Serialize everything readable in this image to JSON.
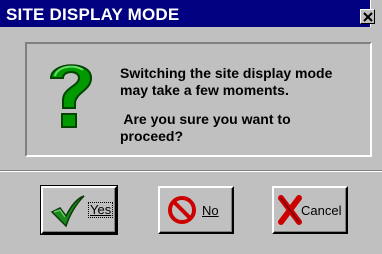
{
  "dialog": {
    "title": "SITE DISPLAY MODE",
    "close_icon": "close-icon"
  },
  "message": {
    "icon": "question-mark-icon",
    "line1": "Switching the site display mode",
    "line2": "may take a few moments.",
    "line3": " Are you sure you want to",
    "line4": "proceed?"
  },
  "buttons": {
    "yes": {
      "label": "Yes",
      "icon": "checkmark-icon",
      "accent": "#1a8a1a"
    },
    "no": {
      "label": "No",
      "icon": "no-symbol-icon",
      "accent": "#cc0000"
    },
    "cancel": {
      "label": "Cancel",
      "icon": "red-x-icon",
      "accent": "#cc0000"
    }
  },
  "colors": {
    "titlebar": "#000080",
    "face": "#c0c0c0",
    "question_mark": "#009900"
  }
}
